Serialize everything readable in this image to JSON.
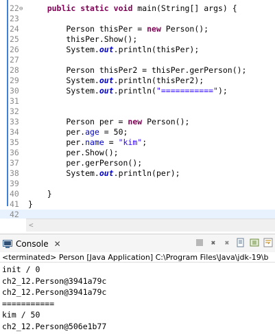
{
  "editor": {
    "lines": [
      {
        "n": "22",
        "fold": "⊖",
        "segs": [
          [
            "    ",
            ""
          ],
          [
            "public",
            "kw"
          ],
          [
            " ",
            ""
          ],
          [
            "static",
            "kw"
          ],
          [
            " ",
            ""
          ],
          [
            "void",
            "kw"
          ],
          [
            " main(String[] args) {",
            ""
          ]
        ]
      },
      {
        "n": "23",
        "segs": []
      },
      {
        "n": "24",
        "segs": [
          [
            "        Person thisPer = ",
            ""
          ],
          [
            "new",
            "kw"
          ],
          [
            " Person();",
            ""
          ]
        ]
      },
      {
        "n": "25",
        "segs": [
          [
            "        thisPer.Show();",
            ""
          ]
        ]
      },
      {
        "n": "26",
        "segs": [
          [
            "        System.",
            ""
          ],
          [
            "out",
            "st"
          ],
          [
            ".println(thisPer);",
            ""
          ]
        ]
      },
      {
        "n": "27",
        "segs": []
      },
      {
        "n": "28",
        "segs": [
          [
            "        Person thisPer2 = thisPer.gerPerson();",
            ""
          ]
        ]
      },
      {
        "n": "29",
        "segs": [
          [
            "        System.",
            ""
          ],
          [
            "out",
            "st"
          ],
          [
            ".println(thisPer2);",
            ""
          ]
        ]
      },
      {
        "n": "30",
        "segs": [
          [
            "        System.",
            ""
          ],
          [
            "out",
            "st"
          ],
          [
            ".println(",
            ""
          ],
          [
            "\"===========\"",
            "str"
          ],
          [
            ");",
            ""
          ]
        ]
      },
      {
        "n": "31",
        "segs": []
      },
      {
        "n": "32",
        "segs": []
      },
      {
        "n": "33",
        "segs": [
          [
            "        Person per = ",
            ""
          ],
          [
            "new",
            "kw"
          ],
          [
            " Person();",
            ""
          ]
        ]
      },
      {
        "n": "34",
        "segs": [
          [
            "        per.",
            ""
          ],
          [
            "age",
            "fld"
          ],
          [
            " = 50;",
            ""
          ]
        ]
      },
      {
        "n": "35",
        "segs": [
          [
            "        per.",
            ""
          ],
          [
            "name",
            "fld"
          ],
          [
            " = ",
            ""
          ],
          [
            "\"kim\"",
            "str"
          ],
          [
            ";",
            ""
          ]
        ]
      },
      {
        "n": "36",
        "segs": [
          [
            "        per.Show();",
            ""
          ]
        ]
      },
      {
        "n": "37",
        "segs": [
          [
            "        per.gerPerson();",
            ""
          ]
        ]
      },
      {
        "n": "38",
        "segs": [
          [
            "        System.",
            ""
          ],
          [
            "out",
            "st"
          ],
          [
            ".println(per);",
            ""
          ]
        ]
      },
      {
        "n": "39",
        "segs": []
      },
      {
        "n": "40",
        "segs": [
          [
            "    }",
            ""
          ]
        ]
      },
      {
        "n": "41",
        "segs": [
          [
            "}",
            ""
          ]
        ]
      },
      {
        "n": "42",
        "segs": [],
        "current": true
      }
    ]
  },
  "console": {
    "tab_label": "Console",
    "status": "<terminated> Person [Java Application] C:\\Program Files\\Java\\jdk-19\\b",
    "output": [
      "init / 0",
      "ch2_12.Person@3941a79c",
      "ch2_12.Person@3941a79c",
      "===========",
      "kim / 50",
      "ch2_12.Person@506e1b77"
    ]
  },
  "colors": {
    "keyword": "#7f0055",
    "field": "#0000c0",
    "string": "#2a00ff",
    "line_number": "#8a8a8a"
  }
}
